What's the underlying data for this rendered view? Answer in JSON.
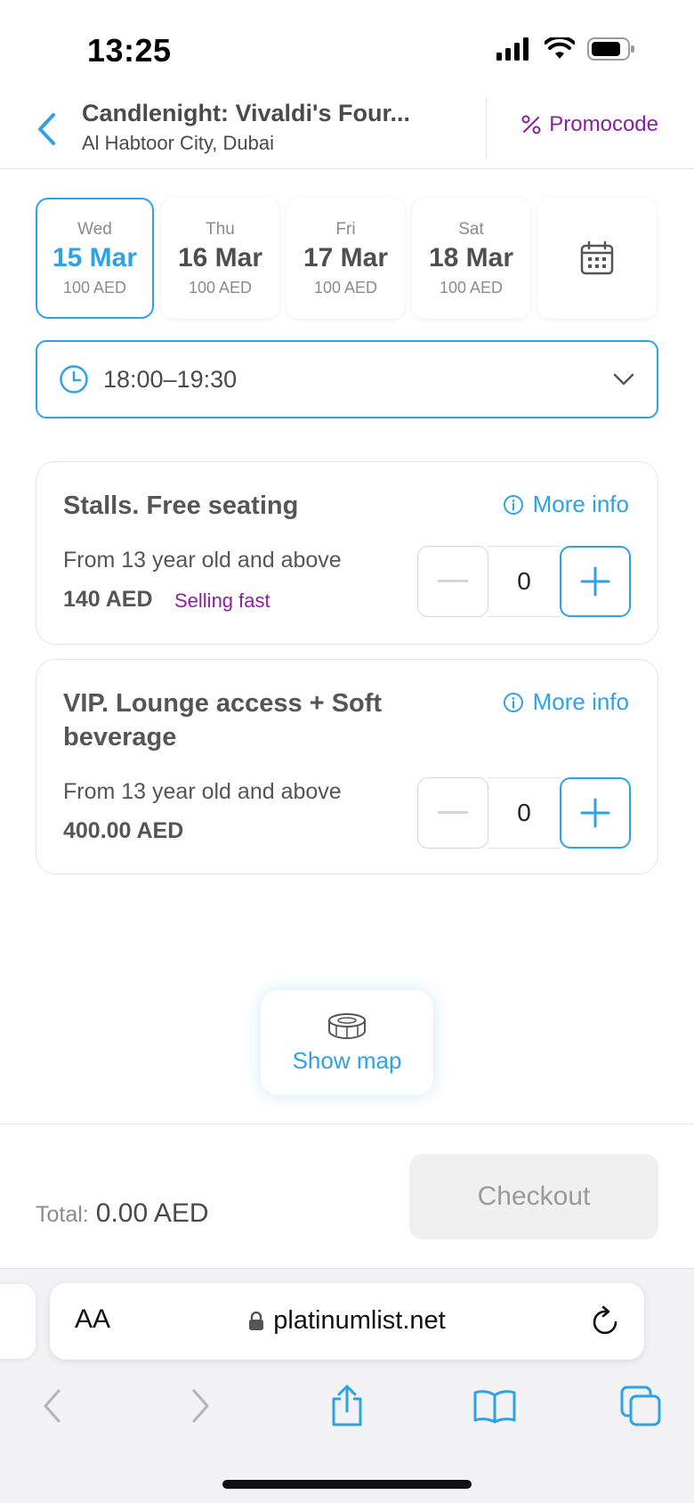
{
  "status_bar": {
    "time": "13:25"
  },
  "header": {
    "title": "Candlenight: Vivaldi's Four...",
    "venue": "Al Habtoor City, Dubai",
    "promocode_label": "Promocode"
  },
  "dates": [
    {
      "day": "Wed",
      "date": "15 Mar",
      "price": "100 AED",
      "selected": true
    },
    {
      "day": "Thu",
      "date": "16 Mar",
      "price": "100 AED",
      "selected": false
    },
    {
      "day": "Fri",
      "date": "17 Mar",
      "price": "100 AED",
      "selected": false
    },
    {
      "day": "Sat",
      "date": "18 Mar",
      "price": "100 AED",
      "selected": false
    }
  ],
  "time_select": {
    "value": "18:00–19:30"
  },
  "tickets": [
    {
      "name": "Stalls. Free seating",
      "more_info": "More info",
      "age": "From 13 year old and above",
      "price": "140 AED",
      "badge": "Selling fast",
      "quantity": "0"
    },
    {
      "name": "VIP. Lounge access + Soft beverage",
      "more_info": "More info",
      "age": "From 13 year old and above",
      "price": "400.00 AED",
      "quantity": "0"
    }
  ],
  "map": {
    "label": "Show map"
  },
  "footer": {
    "total_label": "Total:",
    "total_value": "0.00 AED",
    "checkout_label": "Checkout"
  },
  "browser": {
    "text_size_label": "AA",
    "url": "platinumlist.net"
  },
  "colors": {
    "accent": "#2ea2e6",
    "promo": "#8a1fa0",
    "text": "#4a4a4a"
  }
}
